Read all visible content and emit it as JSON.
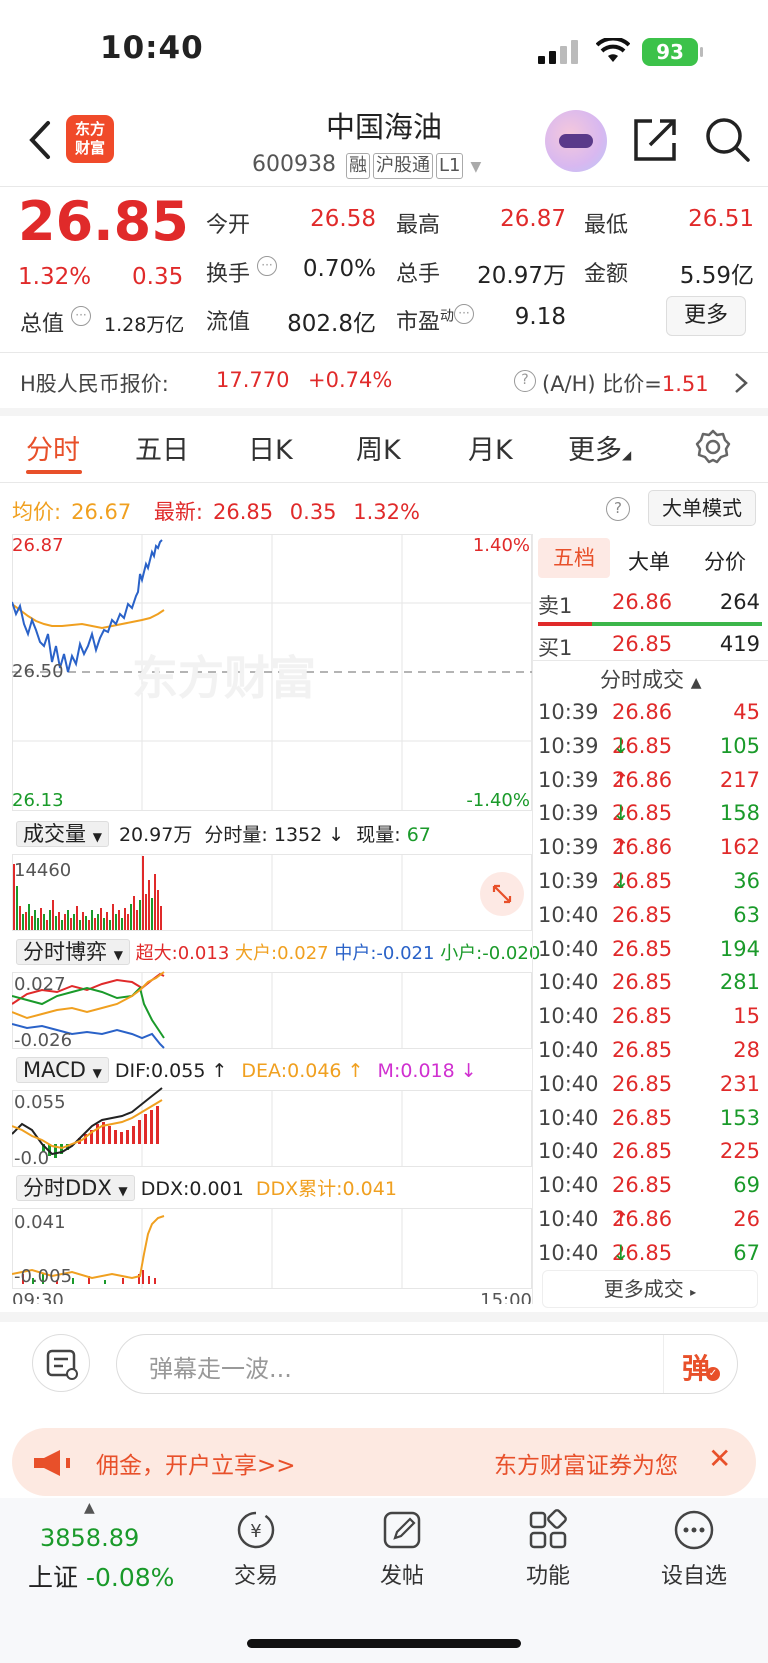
{
  "status": {
    "time": "10:40",
    "battery": "93"
  },
  "header": {
    "logo": "东方财富",
    "stock_name": "中国海油",
    "stock_code": "600938",
    "tags": [
      "融",
      "沪股通",
      "L1"
    ]
  },
  "quote": {
    "price": "26.85",
    "change_pct": "1.32%",
    "change": "0.35",
    "open_label": "今开",
    "open": "26.58",
    "high_label": "最高",
    "high": "26.87",
    "low_label": "最低",
    "low": "26.51",
    "turnover_label": "换手",
    "turnover": "0.70%",
    "volume_label": "总手",
    "volume": "20.97万",
    "amount_label": "金额",
    "amount": "5.59亿",
    "mktcap_label": "总值",
    "mktcap": "1.28万亿",
    "float_label": "流值",
    "float": "802.8亿",
    "pe_label": "市盈",
    "pe_sup": "动",
    "pe": "9.18",
    "more_label": "更多"
  },
  "hshare": {
    "label": "H股人民币报价:",
    "price": "17.770",
    "change": "+0.74%",
    "ratio_label": "(A/H) 比价=",
    "ratio": "1.51"
  },
  "tabs": [
    "分时",
    "五日",
    "日K",
    "周K",
    "月K",
    "更多"
  ],
  "chart_info": {
    "avg_label": "均价:",
    "avg": "26.67",
    "latest_label": "最新:",
    "latest": "26.85",
    "latest_change": "0.35",
    "latest_pct": "1.32%",
    "mode_btn": "大单模式"
  },
  "price_chart": {
    "top_price": "26.87",
    "mid_price": "26.50",
    "bottom_price": "26.13",
    "top_pct": "1.40%",
    "bottom_pct": "-1.40%",
    "watermark": "东方财富"
  },
  "volume_panel": {
    "dropdown": "成交量",
    "total": "20.97万",
    "min_label": "分时量:",
    "min_vol": "1352",
    "now_label": "现量:",
    "now_vol": "67",
    "axis_max": "14460"
  },
  "bobai_panel": {
    "dropdown": "分时博弈",
    "super_label": "超大:",
    "super": "0.013",
    "big_label": "大户:",
    "big": "0.027",
    "mid_label": "中户:",
    "mid": "-0.021",
    "small_label": "小户:",
    "small": "-0.020",
    "axis_top": "0.027",
    "axis_bottom": "-0.026"
  },
  "macd_panel": {
    "dropdown": "MACD",
    "dif_label": "DIF:",
    "dif": "0.055",
    "dea_label": "DEA:",
    "dea": "0.046",
    "m_label": "M:",
    "m": "0.018",
    "axis_top": "0.055",
    "axis_bottom": "-0.0"
  },
  "ddx_panel": {
    "dropdown": "分时DDX",
    "ddx_label": "DDX:",
    "ddx": "0.001",
    "sum_label": "DDX累计:",
    "sum": "0.041",
    "axis_top": "0.041",
    "axis_bottom": "-0.005"
  },
  "time_axis": {
    "start": "09:30",
    "end": "15:00"
  },
  "right_panel": {
    "tabs": [
      "五档",
      "大单",
      "分价"
    ],
    "sell1_label": "卖1",
    "sell1_price": "26.86",
    "sell1_vol": "264",
    "buy1_label": "买1",
    "buy1_price": "26.85",
    "buy1_vol": "419",
    "deals_title": "分时成交",
    "deals": [
      {
        "time": "10:39",
        "price": "26.86",
        "dir": "",
        "vol": "45",
        "color": "red"
      },
      {
        "time": "10:39",
        "price": "26.85",
        "dir": "↓",
        "vol": "105",
        "color": "green"
      },
      {
        "time": "10:39",
        "price": "26.86",
        "dir": "↑",
        "vol": "217",
        "color": "red"
      },
      {
        "time": "10:39",
        "price": "26.85",
        "dir": "↓",
        "vol": "158",
        "color": "green"
      },
      {
        "time": "10:39",
        "price": "26.86",
        "dir": "↑",
        "vol": "162",
        "color": "red"
      },
      {
        "time": "10:39",
        "price": "26.85",
        "dir": "↓",
        "vol": "36",
        "color": "green"
      },
      {
        "time": "10:40",
        "price": "26.85",
        "dir": "",
        "vol": "63",
        "color": "green"
      },
      {
        "time": "10:40",
        "price": "26.85",
        "dir": "",
        "vol": "194",
        "color": "green"
      },
      {
        "time": "10:40",
        "price": "26.85",
        "dir": "",
        "vol": "281",
        "color": "green"
      },
      {
        "time": "10:40",
        "price": "26.85",
        "dir": "",
        "vol": "15",
        "color": "red"
      },
      {
        "time": "10:40",
        "price": "26.85",
        "dir": "",
        "vol": "28",
        "color": "red"
      },
      {
        "time": "10:40",
        "price": "26.85",
        "dir": "",
        "vol": "231",
        "color": "red"
      },
      {
        "time": "10:40",
        "price": "26.85",
        "dir": "",
        "vol": "153",
        "color": "green"
      },
      {
        "time": "10:40",
        "price": "26.85",
        "dir": "",
        "vol": "225",
        "color": "red"
      },
      {
        "time": "10:40",
        "price": "26.85",
        "dir": "",
        "vol": "69",
        "color": "green"
      },
      {
        "time": "10:40",
        "price": "26.86",
        "dir": "↑",
        "vol": "26",
        "color": "red"
      },
      {
        "time": "10:40",
        "price": "26.85",
        "dir": "↓",
        "vol": "67",
        "color": "green"
      }
    ],
    "more_deals": "更多成交"
  },
  "danmu": {
    "placeholder": "弹幕走一波...",
    "btn": "弹"
  },
  "banner": {
    "left_text": "佣金，开户立享>>",
    "right_text": "东方财富证券为您"
  },
  "bottom_nav": {
    "index_value": "3858.89",
    "index_label": "上证",
    "index_change": "-0.08%",
    "items": [
      "交易",
      "发帖",
      "功能",
      "设自选"
    ]
  }
}
